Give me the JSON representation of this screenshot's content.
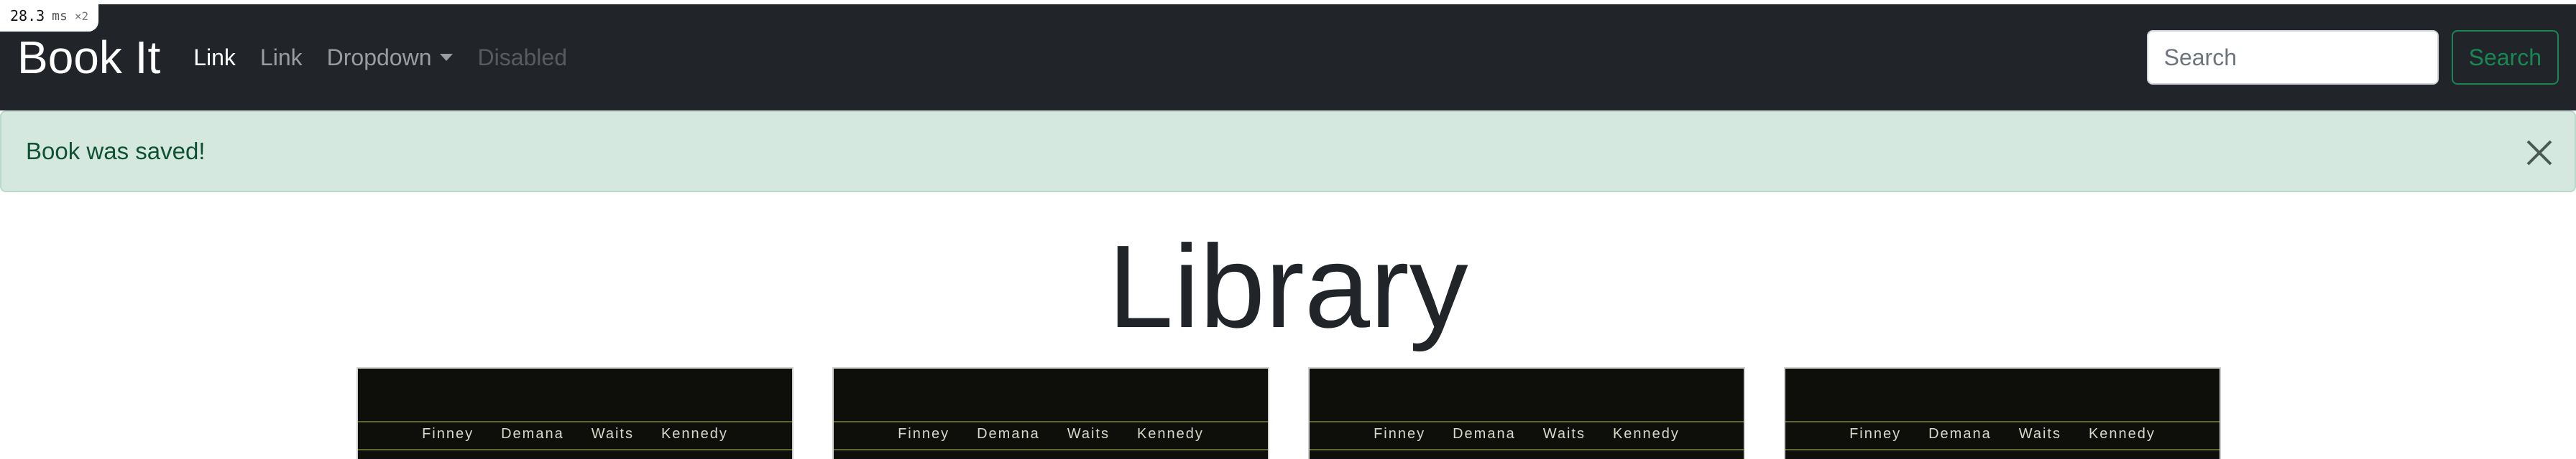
{
  "perf": {
    "value": "28.3",
    "unit": "ms",
    "multiplier": "×2"
  },
  "navbar": {
    "brand": "Book It",
    "links": [
      {
        "label": "Link",
        "state": "active"
      },
      {
        "label": "Link",
        "state": "default"
      },
      {
        "label": "Dropdown",
        "state": "dropdown"
      },
      {
        "label": "Disabled",
        "state": "disabled"
      }
    ],
    "search": {
      "placeholder": "Search",
      "button_label": "Search"
    }
  },
  "alert": {
    "message": "Book was saved!"
  },
  "page": {
    "title": "Library"
  },
  "books": [
    {
      "authors": [
        "Finney",
        "Demana",
        "Waits",
        "Kennedy"
      ]
    },
    {
      "authors": [
        "Finney",
        "Demana",
        "Waits",
        "Kennedy"
      ]
    },
    {
      "authors": [
        "Finney",
        "Demana",
        "Waits",
        "Kennedy"
      ]
    },
    {
      "authors": [
        "Finney",
        "Demana",
        "Waits",
        "Kennedy"
      ]
    }
  ],
  "colors": {
    "navbar_bg": "#212529",
    "alert_bg": "#d4e8df",
    "success": "#198754"
  }
}
